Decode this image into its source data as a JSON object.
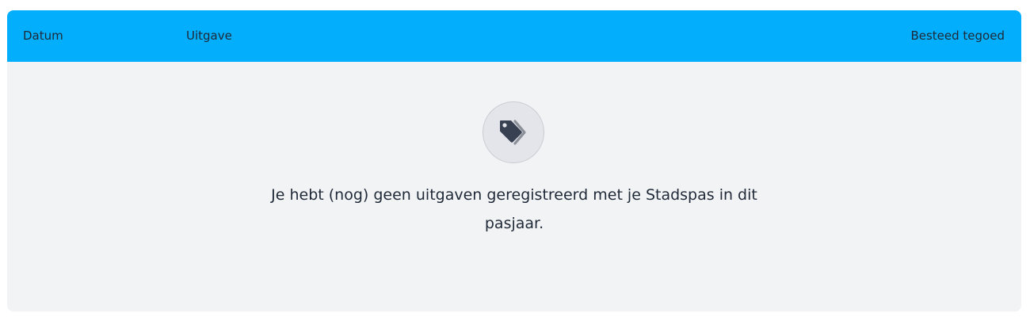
{
  "table": {
    "columns": {
      "date": "Datum",
      "expense": "Uitgave",
      "spent_credit": "Besteed tegoed"
    }
  },
  "empty_state": {
    "icon": "price-tags-icon",
    "message": "Je hebt (nog) geen uitgaven geregistreerd met je Stadspas in dit pasjaar."
  },
  "colors": {
    "header_background": "#03aefc",
    "panel_background": "#f2f3f5",
    "text": "#1f2937"
  }
}
